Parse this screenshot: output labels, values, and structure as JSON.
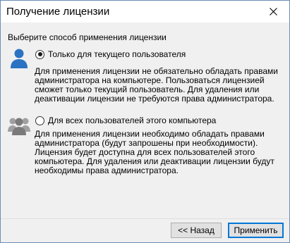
{
  "window": {
    "title": "Получение лицензии",
    "close_icon": "close-icon"
  },
  "prompt": "Выберите способ применения лицензии",
  "options": [
    {
      "label": "Только для текущего пользователя",
      "checked": true,
      "icon": "single-user-icon",
      "description": "Для применения лицензии не обязательно обладать правами\nадминистратора на компьютере. Пользоваться лицензией\nсможет только текущий пользователь. Для удаления или\nдеактивации лицензии не требуются права администратора."
    },
    {
      "label": "Для всех пользователей этого компьютера",
      "checked": false,
      "icon": "user-group-icon",
      "description": "Для применения лицензии необходимо обладать правами\nадминистратора (будут запрошены при необходимости).\nЛицензия будет доступна для всех пользователей этого\nкомпьютера. Для удаления или деактивации лицензии будут\nнеобходимы права администратора."
    }
  ],
  "buttons": {
    "back_label": "<< Назад",
    "apply_label": "Применить"
  },
  "colors": {
    "user_icon_blue": "#2b72c2",
    "group_icon_gray": "#8a8a8a",
    "window_border": "#6b8db5",
    "primary_button_border": "#0078d7"
  }
}
